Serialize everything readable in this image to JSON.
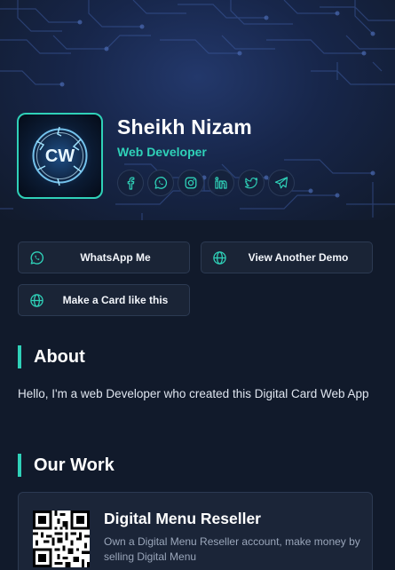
{
  "profile": {
    "name": "Sheikh Nizam",
    "role": "Web Developer",
    "avatar_text": "CW"
  },
  "socials": [
    {
      "icon": "facebook-icon"
    },
    {
      "icon": "whatsapp-icon"
    },
    {
      "icon": "instagram-icon"
    },
    {
      "icon": "linkedin-icon"
    },
    {
      "icon": "twitter-icon"
    },
    {
      "icon": "telegram-icon"
    }
  ],
  "actions": {
    "whatsapp_label": "WhatsApp Me",
    "demo_label": "View Another Demo",
    "make_card_label": "Make a Card like this"
  },
  "about": {
    "title": "About",
    "text": "Hello, I'm a web Developer who created this Digital Card Web App"
  },
  "work": {
    "title": "Our Work",
    "items": [
      {
        "title": "Digital Menu Reseller",
        "description": "Own a Digital Menu Reseller account, make money by selling Digital Menu"
      }
    ]
  },
  "colors": {
    "accent": "#2fd1b8",
    "background": "#111a2b",
    "card": "#1b2538"
  }
}
